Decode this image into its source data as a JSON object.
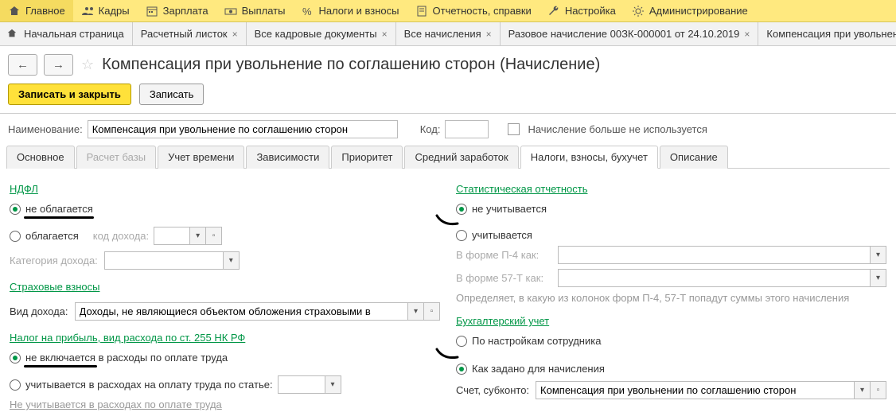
{
  "topmenu": [
    {
      "label": "Главное",
      "icon": "home"
    },
    {
      "label": "Кадры",
      "icon": "people"
    },
    {
      "label": "Зарплата",
      "icon": "calendar"
    },
    {
      "label": "Выплаты",
      "icon": "cash"
    },
    {
      "label": "Налоги и взносы",
      "icon": "percent"
    },
    {
      "label": "Отчетность, справки",
      "icon": "report"
    },
    {
      "label": "Настройка",
      "icon": "wrench"
    },
    {
      "label": "Администрирование",
      "icon": "gear"
    }
  ],
  "tabs": {
    "home": "Начальная страница",
    "items": [
      "Расчетный листок",
      "Все кадровые документы",
      "Все начисления",
      "Разовое начисление 00ЗК-000001 от 24.10.2019",
      "Компенсация при увольнен"
    ]
  },
  "page_title": "Компенсация при увольнение по соглашению сторон (Начисление)",
  "actions": {
    "save_close": "Записать и закрыть",
    "save": "Записать"
  },
  "header": {
    "name_label": "Наименование:",
    "name_value": "Компенсация при увольнение по соглашению сторон",
    "code_label": "Код:",
    "code_value": "",
    "unused_label": "Начисление больше не используется"
  },
  "inner_tabs": [
    "Основное",
    "Расчет базы",
    "Учет времени",
    "Зависимости",
    "Приоритет",
    "Средний заработок",
    "Налоги, взносы, бухучет",
    "Описание"
  ],
  "inner_tabs_disabled_index": 1,
  "inner_tabs_active_index": 6,
  "left": {
    "ndfl_title": "НДФЛ",
    "ndfl_opt1": "не облагается",
    "ndfl_opt2": "облагается",
    "income_code_label": "код дохода:",
    "income_code_value": "",
    "income_category_label": "Категория дохода:",
    "income_category_value": "",
    "ins_title": "Страховые взносы",
    "income_type_label": "Вид дохода:",
    "income_type_value": "Доходы, не являющиеся объектом обложения страховыми в",
    "profit_tax_title": "Налог на прибыль, вид расхода по ст. 255 НК РФ",
    "profit_opt1": "не включается в расходы по оплате труда",
    "profit_opt2": "учитывается в расходах на оплату труда по статье:",
    "profit_article_value": "",
    "profit_note": "Не учитывается в расходах по оплате труда"
  },
  "right": {
    "stat_title": "Статистическая отчетность",
    "stat_opt1": "не учитывается",
    "stat_opt2": "учитывается",
    "p4_label": "В форме П-4 как:",
    "p4_value": "",
    "p57_label": "В форме 57-Т как:",
    "p57_value": "",
    "stat_hint": "Определяет, в какую из колонок форм П-4, 57-Т попадут суммы этого начисления",
    "acc_title": "Бухгалтерский учет",
    "acc_opt1": "По настройкам сотрудника",
    "acc_opt2": "Как задано для начисления",
    "account_label": "Счет, субконто:",
    "account_value": "Компенсация при увольнении по соглашению сторон"
  }
}
